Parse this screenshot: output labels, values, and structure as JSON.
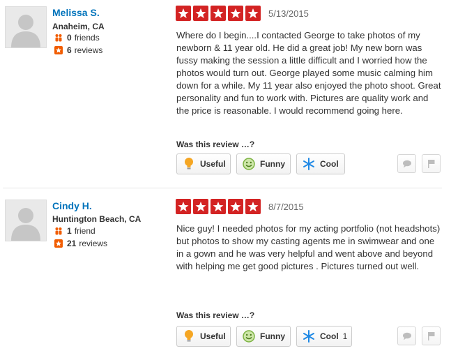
{
  "reviews": [
    {
      "user": {
        "name": "Melissa S.",
        "location": "Anaheim, CA",
        "friends_count": "0",
        "friends_label": "friends",
        "reviews_count": "6",
        "reviews_label": "reviews"
      },
      "rating": 5,
      "date": "5/13/2015",
      "text": "Where do I begin....I contacted George to take photos of my newborn & 11 year old. He did a great job! My new born was fussy making the session a little difficult and I worried how the photos would turn out. George played some music calming him down for a while. My 11 year also enjoyed the photo shoot. Great personality and fun to work with.  Pictures are quality work and the price is reasonable. I would recommend going here.",
      "helpful_prompt": "Was this review …?",
      "votes": {
        "useful": "Useful",
        "funny": "Funny",
        "cool": "Cool",
        "cool_count": ""
      }
    },
    {
      "user": {
        "name": "Cindy H.",
        "location": "Huntington Beach, CA",
        "friends_count": "1",
        "friends_label": "friend",
        "reviews_count": "21",
        "reviews_label": "reviews"
      },
      "rating": 5,
      "date": "8/7/2015",
      "text": "Nice guy! I needed photos for my acting portfolio (not headshots) but photos to show my casting agents me in swimwear and one in a gown and he was very helpful and went above and beyond with helping me get good pictures . Pictures turned out well.",
      "helpful_prompt": "Was this review …?",
      "votes": {
        "useful": "Useful",
        "funny": "Funny",
        "cool": "Cool",
        "cool_count": "1"
      }
    }
  ],
  "colors": {
    "star_red": "#d32323",
    "link_blue": "#0073bb",
    "useful_orange": "#f5a623",
    "funny_green": "#7cb342",
    "cool_blue": "#1e88e5"
  },
  "icons": {
    "useful": "lightbulb-icon",
    "funny": "smiley-icon",
    "cool": "snowflake-icon",
    "friends": "friends-icon",
    "reviews": "review-star-icon",
    "compliment": "speech-bubble-icon",
    "flag": "flag-icon"
  }
}
